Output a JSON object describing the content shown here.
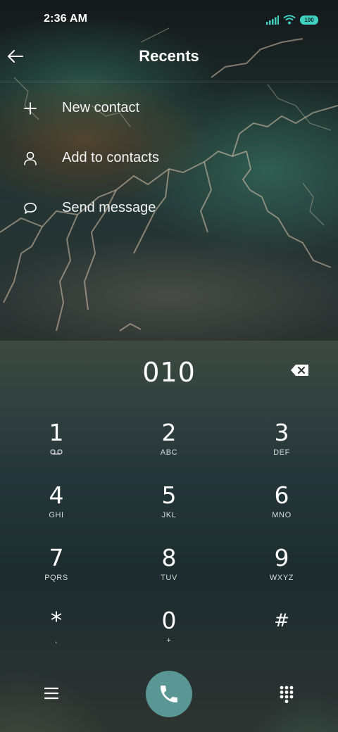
{
  "status_bar": {
    "time": "2:36 AM",
    "battery": "100",
    "icons": [
      "signal-icon",
      "wifi-icon",
      "battery-icon"
    ]
  },
  "header": {
    "title": "Recents",
    "back_icon": "back-arrow-icon"
  },
  "menu": [
    {
      "label": "New contact",
      "icon": "plus-icon"
    },
    {
      "label": "Add to contacts",
      "icon": "person-icon"
    },
    {
      "label": "Send message",
      "icon": "message-icon"
    }
  ],
  "dialer": {
    "number": "010",
    "keys": [
      {
        "digit": "1",
        "letters": ""
      },
      {
        "digit": "2",
        "letters": "ABC"
      },
      {
        "digit": "3",
        "letters": "DEF"
      },
      {
        "digit": "4",
        "letters": "GHI"
      },
      {
        "digit": "5",
        "letters": "JKL"
      },
      {
        "digit": "6",
        "letters": "MNO"
      },
      {
        "digit": "7",
        "letters": "PQRS"
      },
      {
        "digit": "8",
        "letters": "TUV"
      },
      {
        "digit": "9",
        "letters": "WXYZ"
      },
      {
        "digit": "*",
        "letters": ","
      },
      {
        "digit": "0",
        "letters": "+"
      },
      {
        "digit": "#",
        "letters": ""
      }
    ]
  },
  "bottom_bar": {
    "icons": [
      "menu-icon",
      "phone-icon",
      "keypad-icon"
    ]
  },
  "colors": {
    "call_button": "#5a9794",
    "battery": "#3fd0c0"
  }
}
